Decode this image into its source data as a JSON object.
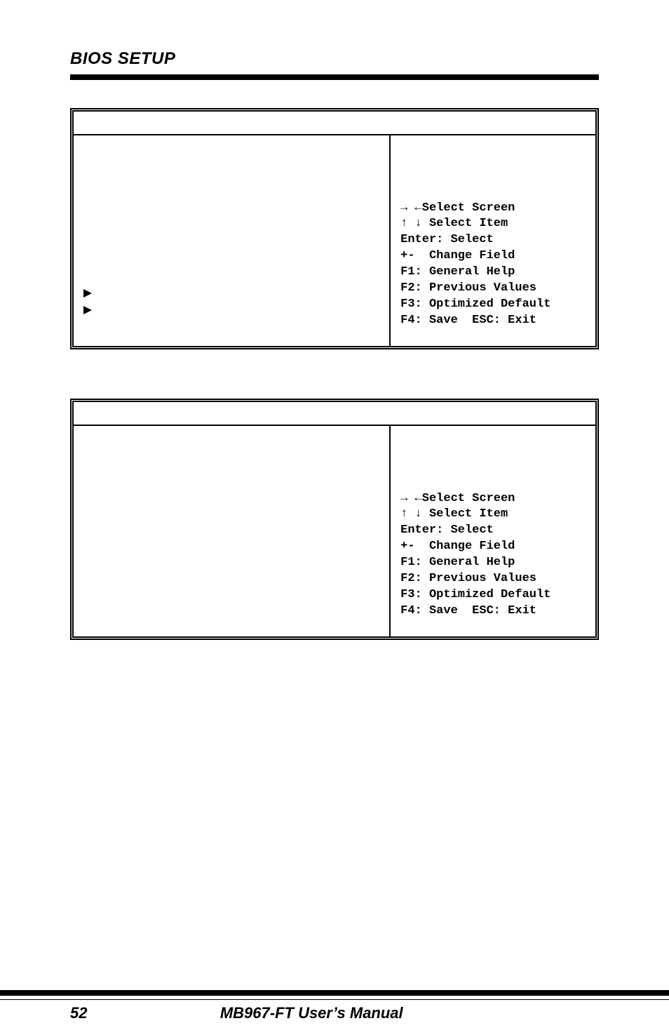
{
  "chapter": "BIOS SETUP",
  "help": {
    "l1": "→ ←Select Screen",
    "l2": "↑ ↓ Select Item",
    "l3": "Enter: Select",
    "l4": "+-  Change Field",
    "l5": "F1: General Help",
    "l6": "F2: Previous Values",
    "l7": "F3: Optimized Default",
    "l8": "F4: Save  ESC: Exit"
  },
  "footer": {
    "page": "52",
    "manual": "MB967-FT User’s Manual"
  }
}
